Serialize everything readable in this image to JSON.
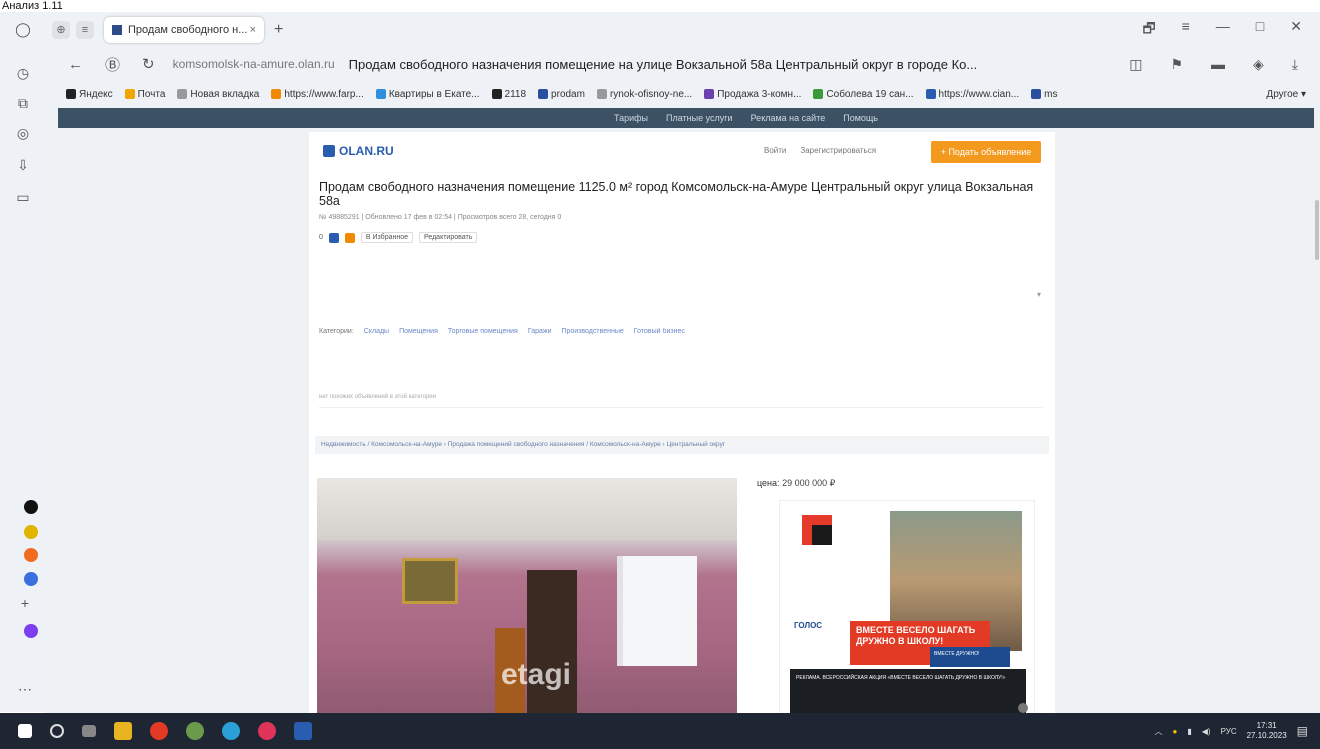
{
  "top_label": "Анализ 1.11",
  "window": {
    "tab_title": "Продам свободного н... ",
    "tab_close": "×",
    "new_tab": "+",
    "controls": [
      "🗗",
      "≡",
      "—",
      "□",
      "✕"
    ]
  },
  "address": {
    "host": "komsomolsk-na-amure.olan.ru",
    "title": "Продам свободного назначения помещение на улице Вокзальной 58а Центральный округ в городе Ко..."
  },
  "bookmarks": [
    {
      "label": "Яндекс",
      "color": "#222"
    },
    {
      "label": "Почта",
      "color": "#f2a400"
    },
    {
      "label": "Новая вкладка",
      "color": "#999"
    },
    {
      "label": "https://www.farp...",
      "color": "#f28a00"
    },
    {
      "label": "Квартиры в Екате...",
      "color": "#2f8fdc"
    },
    {
      "label": "2118",
      "color": "#222"
    },
    {
      "label": "prodam",
      "color": "#2a4fa0"
    },
    {
      "label": "rynok-ofisnoy-ne...",
      "color": "#999"
    },
    {
      "label": "Продажа 3-комн...",
      "color": "#6a3fb0"
    },
    {
      "label": "Соболева 19 сан...",
      "color": "#3a9a3a"
    },
    {
      "label": "https://www.cian...",
      "color": "#2a5db0"
    },
    {
      "label": "ms",
      "color": "#2a4fa0"
    }
  ],
  "bookmarks_other": "Другое ▾",
  "site_top_links": [
    "Тарифы",
    "Платные услуги",
    "Реклама на сайте",
    "Помощь"
  ],
  "logo": "OLAN.RU",
  "header_links": [
    "Войти",
    "Зарегистрироваться"
  ],
  "post_button": "+ Подать объявление",
  "heading": "Продам свободного назначения помещение 1125.0 м² город Комсомольск-на-Амуре Центральный округ улица Вокзальная 58а",
  "meta": "№ 49885291 | Обновлено 17 фев в 02:54 | Просмотров всего 28, сегодня 0",
  "share": {
    "count": "0",
    "chips": [
      "В Избранное",
      "Редактировать"
    ]
  },
  "categories_label": "Категории:",
  "categories": [
    "Склады",
    "Помещения",
    "Торговые помещения",
    "Гаражи",
    "Производственные",
    "Готовый бизнес"
  ],
  "hint": "нет похожих объявлений в этой категории",
  "breadcrumbs": "Недвижимость / Комсомольск-на-Амуре › Продажа помещений свободного назначения / Комсомольск-на-Амуре › Центральный округ",
  "photo_watermark": "etagi",
  "price_label": "цена:",
  "price_value": "29 000 000 ₽",
  "ad": {
    "logo_text": "ГОЛОС",
    "headline": "ВМЕСТЕ ВЕСЕЛО ШАГАТЬ ДРУЖНО В ШКОЛУ!",
    "tag": "ВМЕСТЕ ДРУЖНО!",
    "bottom": "РЕКЛАМА. ВСЕРОССИЙСКАЯ АКЦИЯ «ВМЕСТЕ ВЕСЕЛО ШАГАТЬ ДРУЖНО В ШКОЛУ!»"
  },
  "taskbar": {
    "lang": "РУС",
    "time": "17:31",
    "date": "27.10.2023"
  }
}
